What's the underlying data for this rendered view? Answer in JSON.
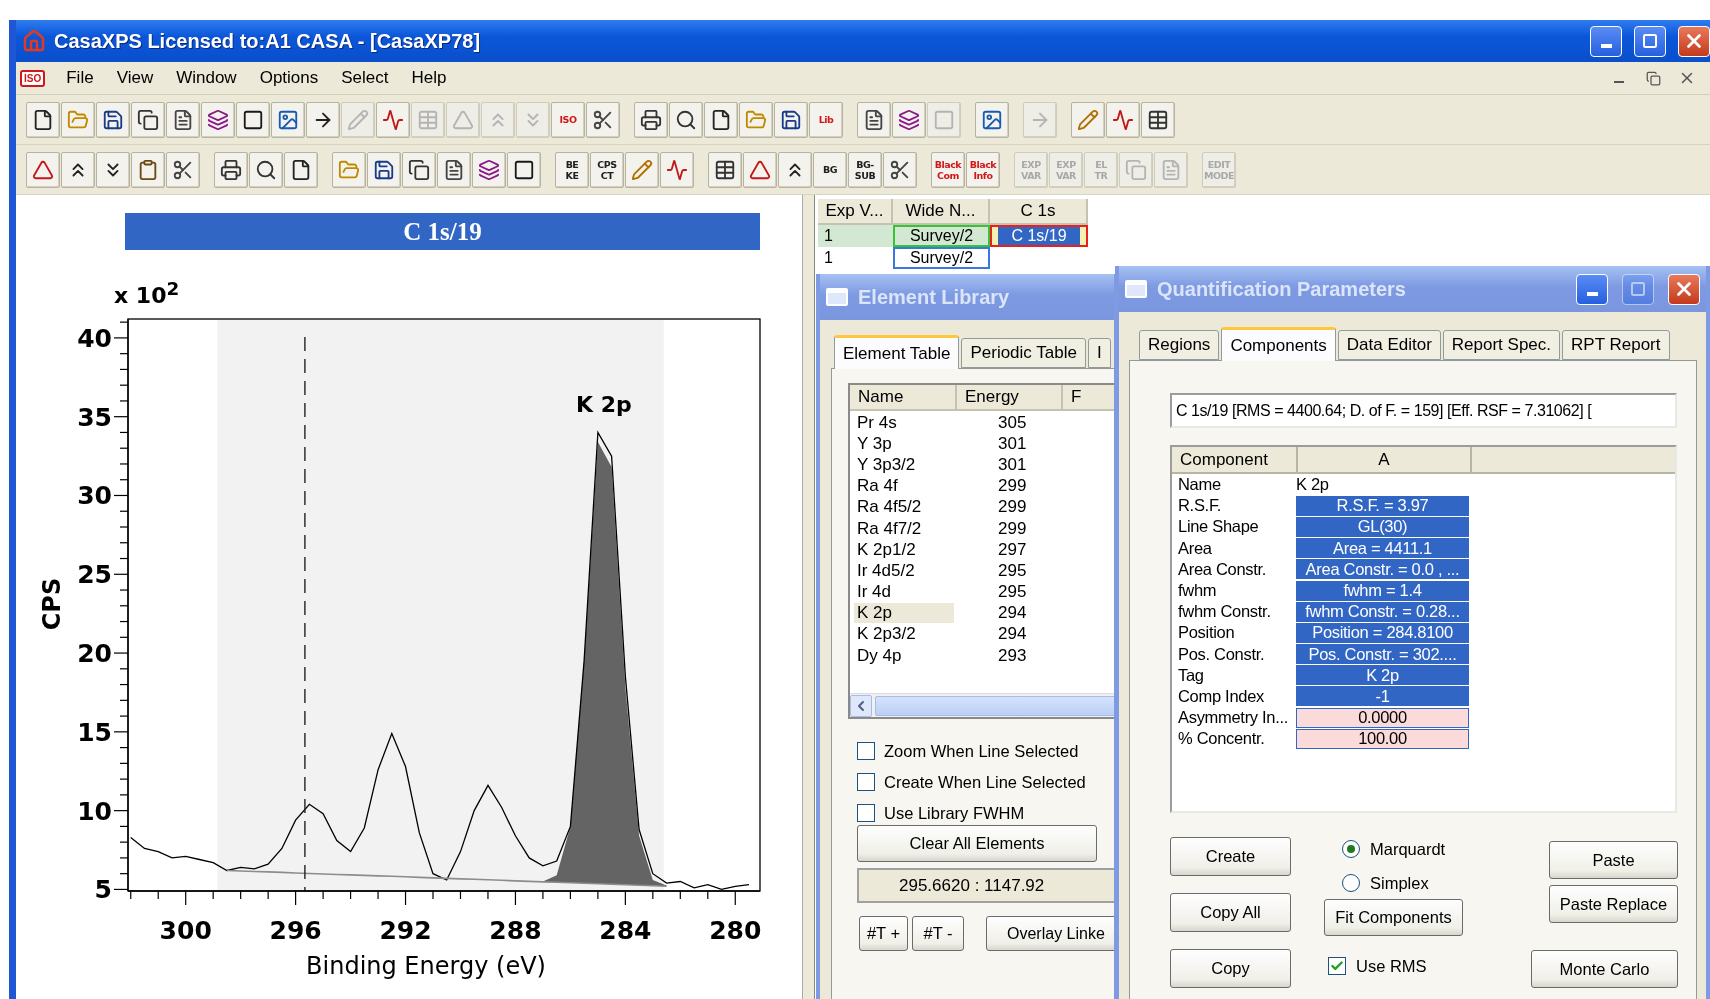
{
  "window": {
    "title": "CasaXPS Licensed to:A1 CASA - [CasaXP78]",
    "controls": [
      {
        "kind": "minimize",
        "disabled": false
      },
      {
        "kind": "maximize",
        "disabled": false
      },
      {
        "kind": "close",
        "disabled": false
      }
    ]
  },
  "menu": {
    "badge": "ISO",
    "items": [
      "File",
      "View",
      "Window",
      "Options",
      "Select",
      "Help"
    ]
  },
  "toolbars": [
    {
      "groups": [
        [
          {
            "kind": "icon",
            "disabled": false
          },
          {
            "kind": "icon",
            "disabled": false
          },
          {
            "kind": "icon",
            "disabled": false
          },
          {
            "kind": "icon",
            "disabled": false
          },
          {
            "kind": "icon",
            "disabled": false
          },
          {
            "kind": "icon",
            "disabled": false
          },
          {
            "kind": "icon",
            "disabled": false
          },
          {
            "kind": "icon",
            "disabled": false
          },
          {
            "kind": "icon",
            "disabled": false
          },
          {
            "kind": "icon",
            "disabled": true
          },
          {
            "kind": "icon",
            "disabled": false
          },
          {
            "kind": "icon",
            "disabled": true
          },
          {
            "kind": "icon",
            "disabled": true
          },
          {
            "kind": "icon",
            "disabled": true
          },
          {
            "kind": "icon",
            "disabled": true
          },
          {
            "kind": "text",
            "lines": [
              "ISO"
            ],
            "color": "#d01818",
            "disabled": false
          },
          {
            "kind": "icon",
            "disabled": false
          }
        ],
        [
          {
            "kind": "icon",
            "disabled": false
          },
          {
            "kind": "icon",
            "disabled": false
          },
          {
            "kind": "icon",
            "disabled": false
          },
          {
            "kind": "icon",
            "disabled": false
          },
          {
            "kind": "icon",
            "disabled": false
          },
          {
            "kind": "text",
            "lines": [
              "Lib"
            ],
            "color": "#d01818",
            "disabled": false
          }
        ],
        [
          {
            "kind": "icon",
            "disabled": false
          },
          {
            "kind": "icon",
            "disabled": false
          },
          {
            "kind": "icon",
            "disabled": true
          }
        ],
        [
          {
            "kind": "icon",
            "disabled": false
          }
        ],
        [
          {
            "kind": "icon",
            "disabled": true
          }
        ],
        [
          {
            "kind": "icon",
            "disabled": false
          },
          {
            "kind": "icon",
            "disabled": false
          },
          {
            "kind": "icon",
            "disabled": false
          }
        ]
      ]
    },
    {
      "groups": [
        [
          {
            "kind": "icon",
            "disabled": false
          },
          {
            "kind": "icon",
            "disabled": false
          },
          {
            "kind": "icon",
            "disabled": false
          },
          {
            "kind": "icon",
            "disabled": false
          },
          {
            "kind": "icon",
            "disabled": false
          }
        ],
        [
          {
            "kind": "icon",
            "disabled": false
          },
          {
            "kind": "icon",
            "disabled": false
          },
          {
            "kind": "icon",
            "disabled": false
          }
        ],
        [
          {
            "kind": "icon",
            "disabled": false
          },
          {
            "kind": "icon",
            "disabled": false
          },
          {
            "kind": "icon",
            "disabled": false
          },
          {
            "kind": "icon",
            "disabled": false
          },
          {
            "kind": "icon",
            "disabled": false
          },
          {
            "kind": "icon",
            "disabled": false
          }
        ],
        [
          {
            "kind": "text",
            "lines": [
              "BE",
              "KE"
            ],
            "color": "#202020",
            "disabled": false
          },
          {
            "kind": "text",
            "lines": [
              "CPS",
              "CT"
            ],
            "color": "#202020",
            "disabled": false
          },
          {
            "kind": "icon",
            "disabled": false
          },
          {
            "kind": "icon",
            "disabled": false
          }
        ],
        [
          {
            "kind": "icon",
            "disabled": false
          },
          {
            "kind": "icon",
            "disabled": false
          },
          {
            "kind": "icon",
            "disabled": false
          },
          {
            "kind": "text",
            "lines": [
              "BG"
            ],
            "color": "#202020",
            "disabled": false
          },
          {
            "kind": "text",
            "lines": [
              "BG-",
              "SUB"
            ],
            "color": "#202020",
            "disabled": false
          },
          {
            "kind": "icon",
            "disabled": false
          }
        ],
        [
          {
            "kind": "text",
            "lines": [
              "Black",
              "Com"
            ],
            "color": "#d01818",
            "disabled": false
          },
          {
            "kind": "text",
            "lines": [
              "Black",
              "Info"
            ],
            "color": "#d01818",
            "disabled": false
          }
        ],
        [
          {
            "kind": "text",
            "lines": [
              "EXP",
              "VAR"
            ],
            "color": "#a8a8a8",
            "disabled": true
          },
          {
            "kind": "text",
            "lines": [
              "EXP",
              "VAR"
            ],
            "color": "#a8a8a8",
            "disabled": true
          },
          {
            "kind": "text",
            "lines": [
              "EL",
              "TR"
            ],
            "color": "#a8a8a8",
            "disabled": true
          },
          {
            "kind": "icon",
            "disabled": true
          },
          {
            "kind": "icon",
            "disabled": true
          }
        ],
        [
          {
            "kind": "text",
            "lines": [
              "EDIT",
              "MODE"
            ],
            "color": "#a8a8a8",
            "disabled": true
          }
        ]
      ]
    }
  ],
  "spectrum": {
    "scale_label": "x 10$^{2}$",
    "chart_data": {
      "type": "line",
      "title": "C 1s/19",
      "xlabel": "Binding Energy (eV)",
      "ylabel": "CPS",
      "xlim": [
        302.1,
        279.1
      ],
      "ylim": [
        4.9,
        41.2
      ],
      "xticks": [
        300,
        296,
        292,
        288,
        284,
        280
      ],
      "yticks": [
        5,
        10,
        15,
        20,
        25,
        30,
        35,
        40
      ],
      "x": [
        302,
        301.5,
        301,
        300.5,
        300,
        299.5,
        299,
        298.5,
        298,
        297.5,
        297,
        296.5,
        296,
        295.5,
        295,
        294.5,
        294,
        293.5,
        293,
        292.5,
        292,
        291.5,
        291,
        290.5,
        290,
        289.5,
        289,
        288.5,
        288,
        287.5,
        287,
        286.5,
        286,
        285.5,
        285,
        284.5,
        284,
        283.5,
        283,
        282.5,
        282,
        281.5,
        281,
        280.5,
        280,
        279.5
      ],
      "series": [
        {
          "color": "#000000",
          "values": [
            8.3,
            7.6,
            7.4,
            7.0,
            7.1,
            6.9,
            6.7,
            6.2,
            6.4,
            6.3,
            6.6,
            7.6,
            9.4,
            10.4,
            9.8,
            8.1,
            7.4,
            8.9,
            12.6,
            14.9,
            12.8,
            8.6,
            6.0,
            5.6,
            7.4,
            10.0,
            11.6,
            10.2,
            8.4,
            7.0,
            6.5,
            6.8,
            9.0,
            19.5,
            34.0,
            32.5,
            18.5,
            8.8,
            6.0,
            5.4,
            5.5,
            5.1,
            5.3,
            5.0,
            5.2,
            5.3
          ]
        },
        {
          "color": "#8c8c8c",
          "values": [
            null,
            null,
            null,
            null,
            null,
            null,
            null,
            6.2,
            6.17,
            6.14,
            6.11,
            6.08,
            6.04,
            6.01,
            5.98,
            5.95,
            5.92,
            5.89,
            5.86,
            5.83,
            5.8,
            5.76,
            5.73,
            5.7,
            5.67,
            5.64,
            5.61,
            5.58,
            5.54,
            5.51,
            5.48,
            5.45,
            5.42,
            5.39,
            5.36,
            5.33,
            5.3,
            5.26,
            5.23,
            5.2,
            null,
            null,
            null,
            null,
            null,
            null
          ]
        },
        {
          "type": "area",
          "color": "#646464",
          "values": [
            null,
            null,
            null,
            null,
            null,
            null,
            null,
            null,
            null,
            null,
            null,
            null,
            null,
            null,
            null,
            null,
            null,
            null,
            null,
            null,
            null,
            null,
            null,
            null,
            null,
            null,
            null,
            null,
            null,
            null,
            5.5,
            5.9,
            9.0,
            19.5,
            33.4,
            31.8,
            17.8,
            8.4,
            5.6,
            5.25,
            null,
            null,
            null,
            null,
            null,
            null
          ]
        }
      ],
      "bands": [
        {
          "axis": "x",
          "from": 298.85,
          "to": 282.6
        }
      ],
      "ref_lines": [
        {
          "axis": "x",
          "value": 295.662
        }
      ],
      "annotations": [
        "K 2p"
      ]
    }
  },
  "browser": {
    "columns": [
      "Exp V...",
      "Wide N...",
      "C 1s"
    ],
    "rows": [
      {
        "current": true,
        "cells": [
          {
            "text": "1",
            "selected": false,
            "framed": false
          },
          {
            "text": "Survey/2",
            "selected": false,
            "framed": true
          },
          {
            "text": "C 1s/19",
            "selected": true,
            "framed": false
          }
        ]
      },
      {
        "current": false,
        "cells": [
          {
            "text": "1",
            "selected": false,
            "framed": false
          },
          {
            "text": "Survey/2",
            "selected": false,
            "framed": true
          }
        ]
      }
    ]
  },
  "element_library": {
    "title": "Element Library",
    "tabs": [
      {
        "label": "Element Table",
        "selected": true
      },
      {
        "label": "Periodic Table",
        "selected": false
      },
      {
        "label": "I",
        "selected": false
      }
    ],
    "columns": [
      "Name",
      "Energy",
      "F"
    ],
    "rows": [
      {
        "name": "Pr 4s",
        "energy": "305",
        "selected": false
      },
      {
        "name": "Y 3p",
        "energy": "301",
        "selected": false
      },
      {
        "name": "Y 3p3/2",
        "energy": "301",
        "selected": false
      },
      {
        "name": "Ra 4f",
        "energy": "299",
        "selected": false
      },
      {
        "name": "Ra 4f5/2",
        "energy": "299",
        "selected": false
      },
      {
        "name": "Ra 4f7/2",
        "energy": "299",
        "selected": false
      },
      {
        "name": "K 2p1/2",
        "energy": "297",
        "selected": false
      },
      {
        "name": "Ir 4d5/2",
        "energy": "295",
        "selected": false
      },
      {
        "name": "Ir 4d",
        "energy": "295",
        "selected": false
      },
      {
        "name": "K 2p",
        "energy": "294",
        "selected": true
      },
      {
        "name": "K 2p3/2",
        "energy": "294",
        "selected": false
      },
      {
        "name": "Dy 4p",
        "energy": "293",
        "selected": false
      }
    ],
    "options": [
      {
        "label": "Zoom When Line Selected",
        "checked": false
      },
      {
        "label": "Create When Line Selected",
        "checked": false
      },
      {
        "label": "Use Library FWHM",
        "checked": false
      }
    ],
    "clear_button": "Clear All Elements",
    "readout": "295.6620 : 1147.92",
    "buttons": [
      "#T +",
      "#T -",
      "Overlay Linke"
    ]
  },
  "quantification": {
    "title": "Quantification Parameters",
    "controls": [
      {
        "kind": "minimize",
        "disabled": false
      },
      {
        "kind": "maximize",
        "disabled": true
      },
      {
        "kind": "close",
        "disabled": false
      }
    ],
    "tabs": [
      {
        "label": "Regions",
        "selected": false
      },
      {
        "label": "Components",
        "selected": true
      },
      {
        "label": "Data Editor",
        "selected": false
      },
      {
        "label": "Report Spec.",
        "selected": false
      },
      {
        "label": "RPT Report",
        "selected": false
      }
    ],
    "summary": "C 1s/19 [RMS = 4400.64; D. of F. = 159] [Eff. RSF = 7.31062] [",
    "columns": [
      "Component",
      "A"
    ],
    "rows": [
      {
        "label": "Name",
        "value": "K 2p",
        "kind": "text"
      },
      {
        "label": "R.S.F.",
        "value": "R.S.F. = 3.97",
        "kind": "param"
      },
      {
        "label": "Line Shape",
        "value": "GL(30)",
        "kind": "param"
      },
      {
        "label": "Area",
        "value": "Area = 4411.1",
        "kind": "param"
      },
      {
        "label": "Area Constr.",
        "value": "Area Constr. = 0.0 , ...",
        "kind": "param"
      },
      {
        "label": "fwhm",
        "value": "fwhm = 1.4",
        "kind": "param"
      },
      {
        "label": "fwhm Constr.",
        "value": "fwhm Constr. = 0.28...",
        "kind": "param"
      },
      {
        "label": "Position",
        "value": "Position = 284.8100",
        "kind": "param"
      },
      {
        "label": "Pos. Constr.",
        "value": "Pos. Constr. = 302....",
        "kind": "param"
      },
      {
        "label": "Tag",
        "value": "K 2p",
        "kind": "param"
      },
      {
        "label": "Comp Index",
        "value": "-1",
        "kind": "param"
      },
      {
        "label": "Asymmetry In...",
        "value": "0.0000",
        "kind": "entry"
      },
      {
        "label": "% Concentr.",
        "value": "100.00",
        "kind": "entry"
      }
    ],
    "left_buttons": [
      "Create",
      "Copy All",
      "Copy"
    ],
    "methods": [
      {
        "label": "Marquardt",
        "selected": true
      },
      {
        "label": "Simplex",
        "selected": false
      }
    ],
    "fit_button": "Fit Components",
    "use_rms": {
      "label": "Use RMS",
      "checked": true
    },
    "right_buttons": [
      "Paste",
      "Paste Replace",
      "Monte Carlo"
    ]
  }
}
